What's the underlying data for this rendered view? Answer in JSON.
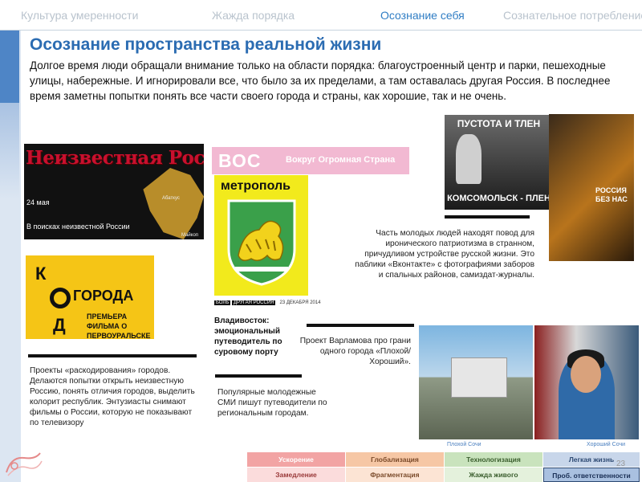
{
  "nav": {
    "items": [
      "Культура умеренности",
      "Жажда порядка",
      "Осознание  себя",
      "Сознательное  потребление"
    ],
    "active_index": 2
  },
  "title": "Осознание пространства  реальной жизни",
  "intro": "Долгое время люди обращали  внимание  только на области порядка: благоустроенный центр и парки,  пешеходные улицы, набережные. И игнорировали  все, что было за их пределами,  а там оставалась другая Россия. В последнее время  заметны попытки  понять все части своего города и страны, как хорошие,  так и не очень.",
  "images": {
    "neizvestnaya": {
      "title": "Неизвестная Россия",
      "date": "24 мая",
      "subtitle": "В поисках неизвестной России",
      "place1": "Абаткус",
      "place2": "Майкоп"
    },
    "kd": {
      "k": "К",
      "d": "Д",
      "goroda": "ГОРОДА",
      "premiere": "ПРЕМЬЕРА ФИЛЬМА О ПЕРВОУРАЛЬСКЕ"
    },
    "vos": {
      "abbr": "ВОС",
      "full": "Вокруг Огромная Страна"
    },
    "metropol": {
      "word": "метрополь"
    },
    "paper": {
      "tag": "БОЛЬ",
      "brand": "ДРУГАЯ РОССИЯ",
      "date": "23 ДЕКАБРЯ 2014"
    },
    "vladivostok": "Владивосток: эмоциональный путеводитель по суровому порту",
    "pustota": {
      "top": "ПУСТОТА И ТЛЕН",
      "bottom": "КОМСОМОЛЬСК - ПЛЕН"
    },
    "russia_bez_nas": "РОССИЯ БЕЗ НАС",
    "captions": {
      "bad": "Плохой Сочи",
      "good": "Хороший Сочи"
    }
  },
  "texts": {
    "patriotism": "Часть молодых людей находят повод для иронического патриотизма в странном, причудливом  устройстве русской жизни.  Это паблики  «Вконтакте» с фотографиями заборов и спальных  районов, самиздат-журналы.",
    "varlamov": "Проект Варламова про грани одного города «Плохой/Хороший».",
    "guides": "Популярные  молодежные СМИ пишут  путеводители по региональным городам.",
    "decoding": "Проекты «раскодирования» городов. Делаются попытки  открыть неизвестную Россию, понять отличия городов, выделить колорит  республик. Энтузиасты  снимают фильмы о России, которую не показывают по телевизору"
  },
  "matrix": {
    "row1": [
      "Ускорение",
      "Глобализация",
      "Технологизация",
      "Легкая жизнь"
    ],
    "row2": [
      "Замедление",
      "Фрагментация",
      "Жажда живого",
      "Проб. ответственности"
    ]
  },
  "page_number": "23"
}
